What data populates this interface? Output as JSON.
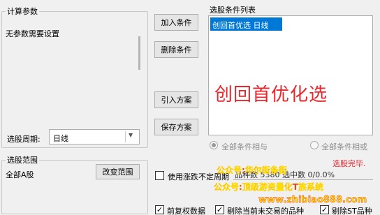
{
  "params": {
    "title": "计算参数",
    "no_params_text": "无参数需要设置",
    "period_label": "选股周期:",
    "period_value": "日线"
  },
  "range": {
    "title": "选股范围",
    "value": "全部A股",
    "change_button": "改变范围"
  },
  "buttons": {
    "add": "加入条件",
    "delete": "删除条件",
    "import": "引入方案",
    "save": "保存方案"
  },
  "conditions": {
    "title": "选股条件列表",
    "items": [
      "创回首优选 日线"
    ],
    "overlay_text": "创回首优化选"
  },
  "logic": {
    "and_label": "全部条件相与",
    "or_label": "全部条件相或",
    "selected": "and"
  },
  "status": {
    "done_text": "选股完毕.",
    "count_text": "品种数 5380    选中数 0/0.0%"
  },
  "options": {
    "limit_label": "使用涨跌不定周期",
    "forward_adjust_label": "前复权数据",
    "exclude_suspended_label": "剔除当前未交易的品种",
    "exclude_st_label": "剔除ST品种"
  },
  "watermark": {
    "line1": "公众号:华尔街条街",
    "line2": "公众号:顶级游资量化T族系统",
    "line3": "www.zhibiao888.com"
  },
  "colors": {
    "selection": "#0078d7",
    "overlay_red": "#e8262b",
    "status_red": "#e8262b"
  }
}
